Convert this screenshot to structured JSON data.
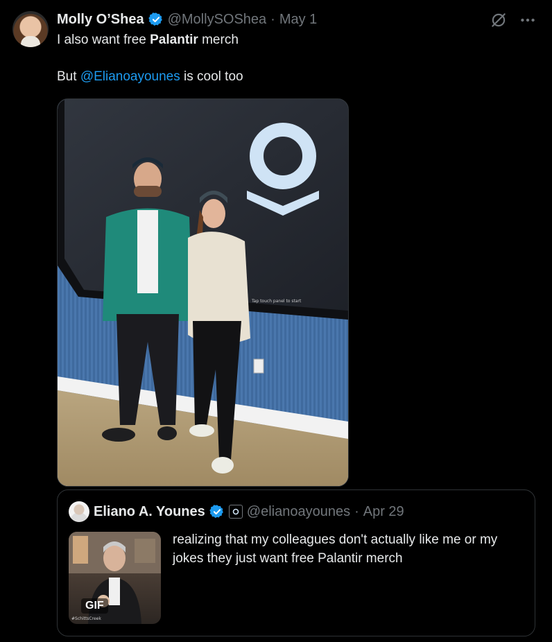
{
  "tweet": {
    "display_name": "Molly O’Shea",
    "handle": "@MollySOShea",
    "separator": "·",
    "date": "May 1",
    "text_part1": "I also want free ",
    "text_bold": "Palantir",
    "text_part2": " merch",
    "text_line2_prefix": "But ",
    "mention": "@Elianoayounes",
    "text_line2_suffix": " is cool too"
  },
  "photo": {
    "screen_caption": "Tap touch panel to start"
  },
  "quote": {
    "display_name": "Eliano A. Younes",
    "handle": "@elianoayounes",
    "separator": "·",
    "date": "Apr 29",
    "text": "realizing that my colleagues don't actually like me or my jokes they just want free Palantir merch",
    "gif_label": "GIF",
    "gif_watermark": "#SchittsCreek"
  },
  "colors": {
    "background": "#000000",
    "text": "#e7e9ea",
    "muted": "#71767b",
    "link": "#1d9bf0",
    "verified": "#1d9bf0"
  },
  "icons": [
    "verified-badge-icon",
    "grok-icon",
    "more-icon",
    "affiliate-badge-icon"
  ]
}
